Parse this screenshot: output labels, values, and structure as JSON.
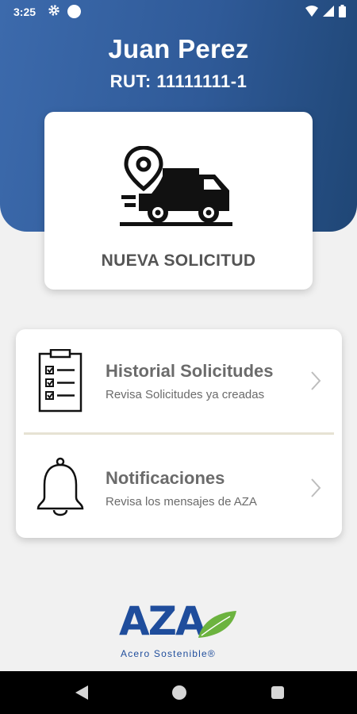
{
  "status_bar": {
    "time": "3:25"
  },
  "user": {
    "name": "Juan Perez",
    "rut": "RUT: 11111111-1"
  },
  "new_request": {
    "label": "NUEVA SOLICITUD",
    "icon": "delivery-truck-location-icon"
  },
  "menu": {
    "items": [
      {
        "title": "Historial Solicitudes",
        "subtitle": "Revisa Solicitudes ya creadas",
        "icon": "clipboard-checklist-icon"
      },
      {
        "title": "Notificaciones",
        "subtitle": "Revisa los mensajes de AZA",
        "icon": "bell-icon"
      }
    ]
  },
  "logo": {
    "name": "AZA",
    "tagline": "Acero Sostenible®"
  },
  "colors": {
    "header_start": "#3c6aac",
    "header_end": "#1f4675",
    "brand_blue": "#1f4d9c",
    "brand_green": "#6cb33f",
    "text_gray": "#6b6b6b",
    "divider": "#e6e2d3"
  }
}
